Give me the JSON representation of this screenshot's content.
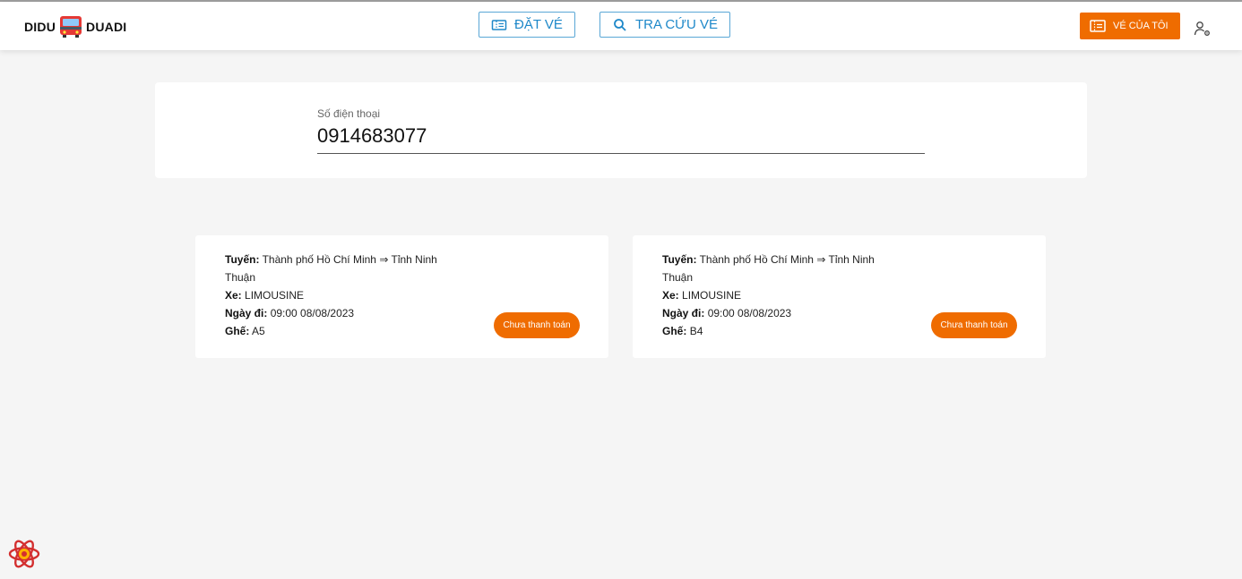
{
  "header": {
    "logo_left": "DIDU",
    "logo_right": "DUADI",
    "logo_icon": "bus-icon",
    "nav": {
      "book_label": "ĐẶT VÉ",
      "book_icon": "ticket-icon",
      "lookup_label": "TRA CỨU VÉ",
      "lookup_icon": "search-icon"
    },
    "my_tickets_label": "VÉ CỦA TÔI",
    "my_tickets_icon": "ticket-icon",
    "user_icon": "user-settings-icon"
  },
  "search": {
    "label": "Số điện thoại",
    "value": "0914683077"
  },
  "tickets": [
    {
      "route_label": "Tuyến:",
      "route": "Thành phố Hồ Chí Minh ⇒ Tỉnh Ninh Thuận",
      "vehicle_label": "Xe:",
      "vehicle": "LIMOUSINE",
      "date_label": "Ngày đi:",
      "date": "09:00 08/08/2023",
      "seat_label": "Ghế:",
      "seat": "A5",
      "status": "Chưa thanh toán"
    },
    {
      "route_label": "Tuyến:",
      "route": "Thành phố Hồ Chí Minh ⇒ Tỉnh Ninh Thuận",
      "vehicle_label": "Xe:",
      "vehicle": "LIMOUSINE",
      "date_label": "Ngày đi:",
      "date": "09:00 08/08/2023",
      "seat_label": "Ghế:",
      "seat": "B4",
      "status": "Chưa thanh toán"
    }
  ],
  "colors": {
    "accent": "#ef6c00",
    "nav_blue": "#1e88c9",
    "background": "#f5f5f5"
  },
  "devtools_icon": "react-logo-icon"
}
